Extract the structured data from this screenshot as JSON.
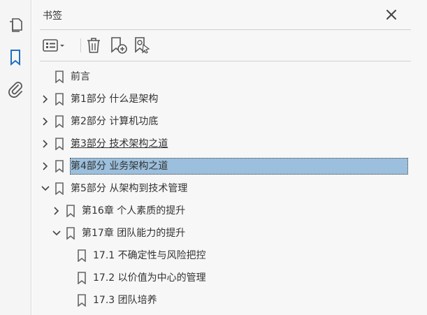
{
  "panel": {
    "title": "书签"
  },
  "leftbar": {
    "icons": [
      "pages-icon",
      "bookmark-icon",
      "attachment-icon"
    ]
  },
  "toolbar": {
    "buttons": [
      "options-menu",
      "delete-bookmark",
      "new-bookmark",
      "new-bookmark-from-structure"
    ]
  },
  "bookmarks": [
    {
      "label": "前言",
      "level": 0,
      "expander": "none"
    },
    {
      "label": "第1部分 什么是架构",
      "level": 0,
      "expander": "collapsed"
    },
    {
      "label": "第2部分 计算机功底",
      "level": 0,
      "expander": "collapsed"
    },
    {
      "label": "第3部分 技术架构之道",
      "level": 0,
      "expander": "collapsed",
      "underlined": true
    },
    {
      "label": "第4部分 业务架构之道",
      "level": 0,
      "expander": "collapsed",
      "selected": true
    },
    {
      "label": "第5部分 从架构到技术管理",
      "level": 0,
      "expander": "expanded"
    },
    {
      "label": "第16章 个人素质的提升",
      "level": 1,
      "expander": "collapsed"
    },
    {
      "label": "第17章 团队能力的提升",
      "level": 1,
      "expander": "expanded"
    },
    {
      "label": "17.1 不确定性与风险把控",
      "level": 2,
      "expander": "none"
    },
    {
      "label": "17.2 以价值为中心的管理",
      "level": 2,
      "expander": "none"
    },
    {
      "label": "17.3 团队培养",
      "level": 2,
      "expander": "none"
    }
  ],
  "colors": {
    "selection": "#9bbfdc",
    "accent": "#1f6fc4",
    "icon": "#555555"
  }
}
